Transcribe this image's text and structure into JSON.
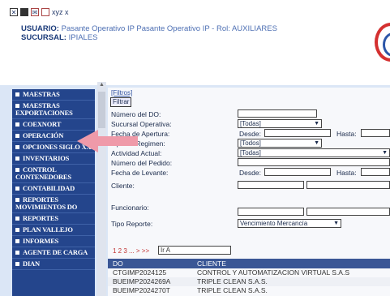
{
  "header": {
    "toolbar_extra": "xyz x",
    "user_label": "USUARIO:",
    "user_value": "Pasante Operativo IP Pasante Operativo IP - Rol: AUXILIARES",
    "branch_label": "SUCURSAL:",
    "branch_value": "IPIALES"
  },
  "sidebar": {
    "items": [
      "MAESTRAS",
      "MAESTRAS EXPORTACIONES",
      "COEXNORT",
      "OPERACIÓN",
      "OPCIONES SIGLO XXI",
      "INVENTARIOS",
      "CONTROL CONTENEDORES",
      "CONTABILIDAD",
      "REPORTES MOVIMIENTOS DO",
      "REPORTES",
      "PLAN VALLEJO",
      "INFORMES",
      "AGENTE DE CARGA",
      "DIAN"
    ]
  },
  "filters": {
    "link": "[Filtros]",
    "button": "Filtrar",
    "numero_do": "Número del DO:",
    "sucursal": "Sucursal Operativa:",
    "sucursal_value": "[Todas]",
    "fecha_apertura": "Fecha de Apertura:",
    "desde": "Desde:",
    "hasta": "Hasta:",
    "tipo_regimen": "Tipo de Regimen:",
    "tipo_regimen_value": "[Todos]",
    "actividad": "Actividad Actual:",
    "actividad_value": "[Todas]",
    "numero_pedido": "Número del Pedido:",
    "fecha_levante": "Fecha de Levante:",
    "desde2": "Desde:",
    "hasta2": "Hasta:",
    "cliente": "Cliente:",
    "funcionario": "Funcionario:",
    "tipo_reporte": "Tipo Reporte:",
    "tipo_reporte_value": "Vencimiento Mercancía"
  },
  "pager": {
    "pages": "1 2 3 ... > >>",
    "go_value": "Ir A"
  },
  "table": {
    "headers": [
      "DO",
      "CLIENTE"
    ],
    "rows": [
      [
        "CTGIMP2024125",
        "CONTROL Y AUTOMATIZACION VIRTUAL S.A.S"
      ],
      [
        "BUEIMP2024269A",
        "TRIPLE CLEAN S.A.S."
      ],
      [
        "BUEIMP2024270T",
        "TRIPLE CLEAN S.A.S."
      ]
    ]
  },
  "colors": {
    "sidebar": "#24458c",
    "table_header": "#3a5695",
    "highlight_arrow": "#ef9aa9"
  }
}
